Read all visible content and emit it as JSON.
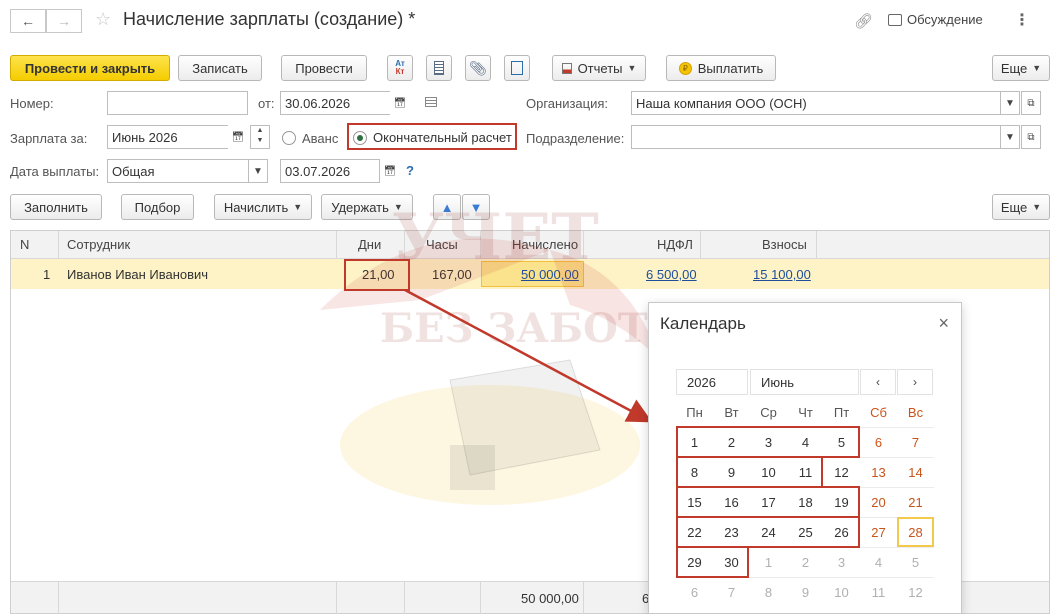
{
  "header": {
    "back_icon": "arrow-left-icon",
    "forward_icon": "arrow-right-icon",
    "star_icon": "star-icon",
    "title": "Начисление зарплаты (создание) *",
    "link_icon": "link-icon",
    "discussion": "Обсуждение",
    "more_icon": "more-vertical-icon"
  },
  "toolbar": {
    "post_and_close": "Провести и закрыть",
    "save": "Записать",
    "post": "Провести",
    "reports": "Отчеты",
    "pay": "Выплатить",
    "more": "Еще"
  },
  "form": {
    "number_label": "Номер:",
    "number_value": "",
    "from_label": "от:",
    "date_value": "30.06.2026",
    "org_label": "Организация:",
    "org_value": "Наша компания ООО (ОСН)",
    "salary_for_label": "Зарплата за:",
    "salary_for_value": "Июнь 2026",
    "advance_label": "Аванс",
    "final_label": "Окончательный расчет",
    "division_label": "Подразделение:",
    "division_value": "",
    "pay_date_label": "Дата выплаты:",
    "pay_date_type": "Общая",
    "pay_date_value": "03.07.2026",
    "help": "?"
  },
  "table_toolbar": {
    "fill": "Заполнить",
    "pick": "Подбор",
    "accrue": "Начислить",
    "withhold": "Удержать",
    "more": "Еще"
  },
  "table": {
    "columns": [
      "N",
      "Сотрудник",
      "Дни",
      "Часы",
      "Начислено",
      "НДФЛ",
      "Взносы"
    ],
    "rows": [
      {
        "n": "1",
        "employee": "Иванов Иван Иванович",
        "days": "21,00",
        "hours": "167,00",
        "accrued": "50 000,00",
        "ndfl": "6 500,00",
        "contrib": "15 100,00"
      }
    ],
    "total_accrued": "50 000,00",
    "total_ndfl_partial": "6"
  },
  "watermark": {
    "line1": "УЧЕТ",
    "line2": "БЕЗ ЗАБОТ"
  },
  "calendar": {
    "title": "Календарь",
    "year": "2026",
    "month": "Июнь",
    "weekdays": [
      "Пн",
      "Вт",
      "Ср",
      "Чт",
      "Пт",
      "Сб",
      "Вс"
    ],
    "weeks": [
      [
        "1",
        "2",
        "3",
        "4",
        "5",
        "6",
        "7"
      ],
      [
        "8",
        "9",
        "10",
        "11",
        "12",
        "13",
        "14"
      ],
      [
        "15",
        "16",
        "17",
        "18",
        "19",
        "20",
        "21"
      ],
      [
        "22",
        "23",
        "24",
        "25",
        "26",
        "27",
        "28"
      ],
      [
        "29",
        "30",
        "1",
        "2",
        "3",
        "4",
        "5"
      ],
      [
        "6",
        "7",
        "8",
        "9",
        "10",
        "11",
        "12"
      ]
    ],
    "today": "28",
    "colors": {
      "weekend": "#c9541a",
      "highlight": "#c0392b",
      "today_border": "#f2c94c"
    }
  }
}
